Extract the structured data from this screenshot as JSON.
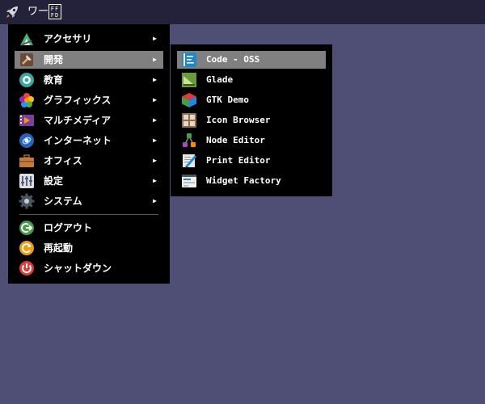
{
  "taskbar": {
    "launcher_icon": "rocket-icon",
    "workspace_label": "ワー",
    "ff_box_top": "FF",
    "ff_box_bottom": "FD"
  },
  "main_menu": {
    "items": [
      {
        "label": "アクセサリ",
        "icon": "accessories-icon",
        "arrow": "▶"
      },
      {
        "label": "開発",
        "icon": "development-icon",
        "arrow": "▶",
        "active": true
      },
      {
        "label": "教育",
        "icon": "education-icon",
        "arrow": "▶"
      },
      {
        "label": "グラフィックス",
        "icon": "graphics-icon",
        "arrow": "▶"
      },
      {
        "label": "マルチメディア",
        "icon": "multimedia-icon",
        "arrow": "▶"
      },
      {
        "label": "インターネット",
        "icon": "internet-icon",
        "arrow": "▶"
      },
      {
        "label": "オフィス",
        "icon": "office-icon",
        "arrow": "▶"
      },
      {
        "label": "設定",
        "icon": "settings-icon",
        "arrow": "▶"
      },
      {
        "label": "システム",
        "icon": "system-icon",
        "arrow": "▶"
      }
    ],
    "session_items": [
      {
        "label": "ログアウト",
        "icon": "logout-icon"
      },
      {
        "label": "再起動",
        "icon": "restart-icon"
      },
      {
        "label": "シャットダウン",
        "icon": "shutdown-icon"
      }
    ]
  },
  "sub_menu": {
    "items": [
      {
        "label": "Code - OSS",
        "icon": "code-oss-icon",
        "active": true
      },
      {
        "label": "Glade",
        "icon": "glade-icon"
      },
      {
        "label": "GTK Demo",
        "icon": "gtk-demo-icon"
      },
      {
        "label": "Icon Browser",
        "icon": "icon-browser-icon"
      },
      {
        "label": "Node Editor",
        "icon": "node-editor-icon"
      },
      {
        "label": "Print Editor",
        "icon": "print-editor-icon"
      },
      {
        "label": "Widget Factory",
        "icon": "widget-factory-icon"
      }
    ]
  },
  "colors": {
    "desktop": "#4f4e74",
    "taskbar": "#23223a",
    "menu": "#000000",
    "highlight": "#808080"
  }
}
